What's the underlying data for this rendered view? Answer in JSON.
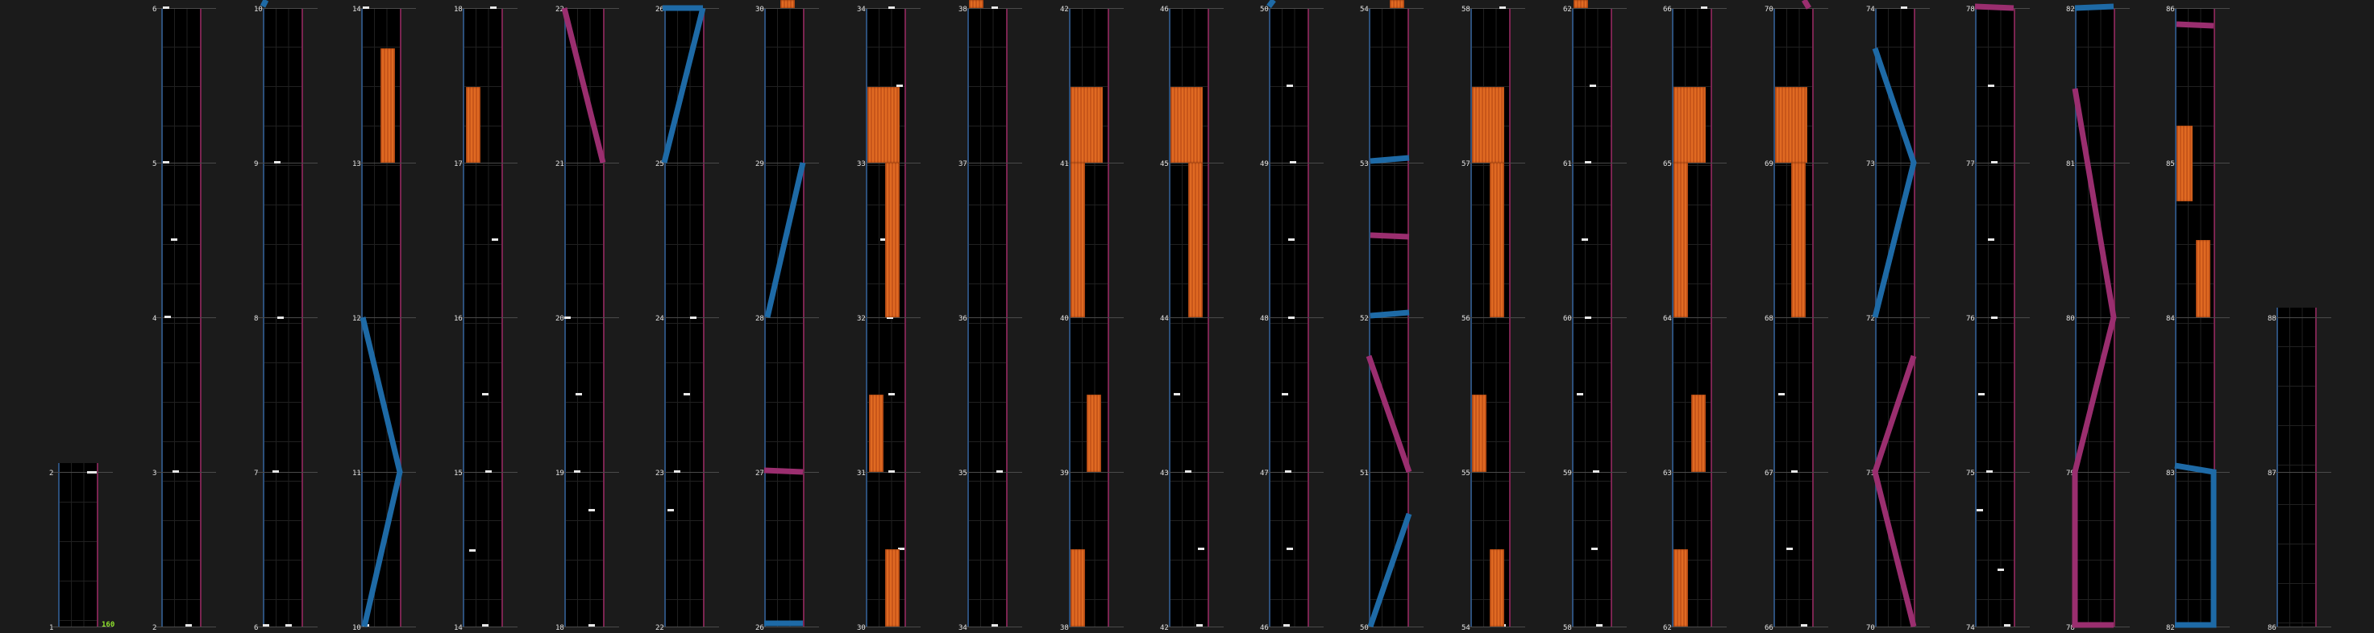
{
  "chart_view": {
    "combo_counter": "160",
    "lanes_per_column": 3,
    "colors": {
      "background": "#1b1b1b",
      "column_bg": "#000000",
      "left_border": "#2c4f7a",
      "right_border": "#7a2450",
      "blue_note": "#1e6aa6",
      "pink_note": "#9a2e6f",
      "hold_note": "#d4601e",
      "tap_note": "#e8e8e8"
    },
    "icons": [
      "tap-note-icon",
      "hold-note-icon",
      "slide-note-icon"
    ],
    "columns": [
      {
        "labels": [
          "2",
          "1"
        ]
      },
      {
        "labels": [
          "6",
          "5",
          "4",
          "3",
          "2"
        ]
      },
      {
        "labels": [
          "10",
          "9",
          "8",
          "7",
          "6"
        ]
      },
      {
        "labels": [
          "14",
          "13",
          "12",
          "11",
          "10"
        ]
      },
      {
        "labels": [
          "18",
          "17",
          "16",
          "15",
          "14"
        ]
      },
      {
        "labels": [
          "22",
          "21",
          "20",
          "19",
          "18"
        ]
      },
      {
        "labels": [
          "26",
          "25",
          "24",
          "23",
          "22"
        ]
      },
      {
        "labels": [
          "30",
          "29",
          "28",
          "27",
          "26"
        ]
      },
      {
        "labels": [
          "34",
          "33",
          "32",
          "31",
          "30"
        ]
      },
      {
        "labels": [
          "38",
          "37",
          "36",
          "35",
          "34"
        ]
      },
      {
        "labels": [
          "42",
          "41",
          "40",
          "39",
          "38"
        ]
      },
      {
        "labels": [
          "46",
          "45",
          "44",
          "43",
          "42"
        ]
      },
      {
        "labels": [
          "50",
          "49",
          "48",
          "47",
          "46"
        ]
      },
      {
        "labels": [
          "54",
          "53",
          "52",
          "51",
          "50"
        ]
      },
      {
        "labels": [
          "58",
          "57",
          "56",
          "55",
          "54"
        ]
      },
      {
        "labels": [
          "62",
          "61",
          "60",
          "59",
          "58"
        ]
      },
      {
        "labels": [
          "66",
          "65",
          "64",
          "63",
          "62"
        ]
      },
      {
        "labels": [
          "70",
          "69",
          "68",
          "67",
          "66"
        ]
      },
      {
        "labels": [
          "74",
          "73",
          "72",
          "71",
          "70"
        ]
      },
      {
        "labels": [
          "78",
          "77",
          "76",
          "75",
          "74"
        ]
      },
      {
        "labels": [
          "82",
          "81",
          "80",
          "79",
          "78"
        ]
      },
      {
        "labels": [
          "86",
          "85",
          "84",
          "83",
          "82"
        ]
      },
      {
        "labels": [
          "88",
          "87",
          "86"
        ]
      }
    ]
  }
}
